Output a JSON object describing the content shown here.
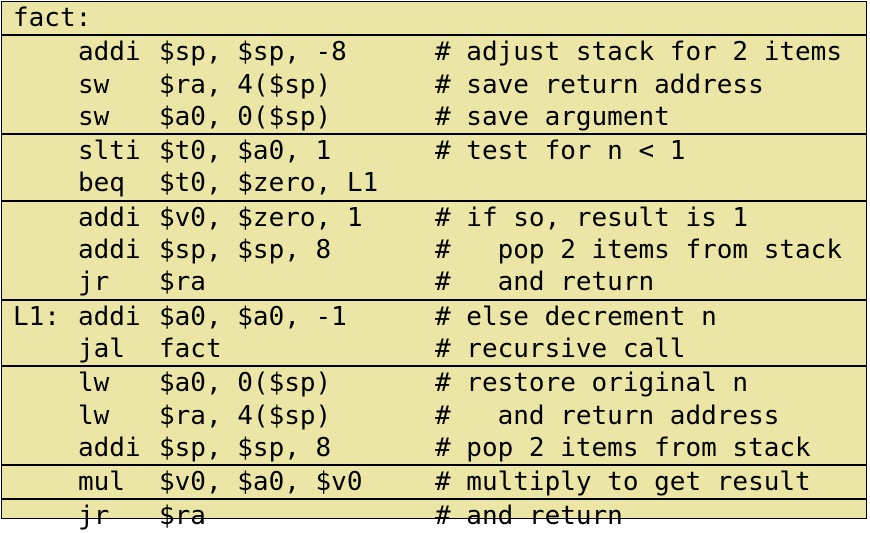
{
  "colors": {
    "background": "#ebe6a5",
    "border": "#000000",
    "text": "#000000"
  },
  "blocks": [
    {
      "lines": [
        {
          "label": "fact:",
          "op": "",
          "args": "",
          "comment": ""
        }
      ]
    },
    {
      "lines": [
        {
          "label": "",
          "op": "addi",
          "args": "$sp, $sp, -8",
          "comment": "# adjust stack for 2 items"
        },
        {
          "label": "",
          "op": "sw",
          "args": "$ra, 4($sp)",
          "comment": "# save return address"
        },
        {
          "label": "",
          "op": "sw",
          "args": "$a0, 0($sp)",
          "comment": "# save argument"
        }
      ]
    },
    {
      "lines": [
        {
          "label": "",
          "op": "slti",
          "args": "$t0, $a0, 1",
          "comment": "# test for n < 1"
        },
        {
          "label": "",
          "op": "beq",
          "args": "$t0, $zero, L1",
          "comment": ""
        }
      ]
    },
    {
      "lines": [
        {
          "label": "",
          "op": "addi",
          "args": "$v0, $zero, 1",
          "comment": "# if so, result is 1"
        },
        {
          "label": "",
          "op": "addi",
          "args": "$sp, $sp, 8",
          "comment": "#   pop 2 items from stack"
        },
        {
          "label": "",
          "op": "jr",
          "args": "$ra",
          "comment": "#   and return"
        }
      ]
    },
    {
      "lines": [
        {
          "label": "L1:",
          "op": "addi",
          "args": "$a0, $a0, -1",
          "comment": "# else decrement n"
        },
        {
          "label": "",
          "op": "jal",
          "args": "fact",
          "comment": "# recursive call"
        }
      ]
    },
    {
      "lines": [
        {
          "label": "",
          "op": "lw",
          "args": "$a0, 0($sp)",
          "comment": "# restore original n"
        },
        {
          "label": "",
          "op": "lw",
          "args": "$ra, 4($sp)",
          "comment": "#   and return address"
        },
        {
          "label": "",
          "op": "addi",
          "args": "$sp, $sp, 8",
          "comment": "# pop 2 items from stack"
        }
      ]
    },
    {
      "lines": [
        {
          "label": "",
          "op": "mul",
          "args": "$v0, $a0, $v0",
          "comment": "# multiply to get result"
        }
      ]
    },
    {
      "lines": [
        {
          "label": "",
          "op": "jr",
          "args": "$ra",
          "comment": "# and return"
        }
      ]
    }
  ]
}
